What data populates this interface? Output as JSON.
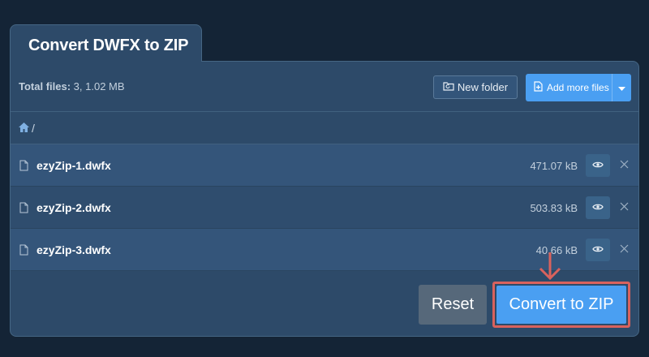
{
  "tab": {
    "title": "Convert DWFX to ZIP"
  },
  "toolbar": {
    "total_label": "Total files:",
    "total_value": "3, 1.02 MB",
    "new_folder_label": "New folder",
    "add_more_label": "Add more files"
  },
  "breadcrumb": {
    "separator": "/"
  },
  "files": [
    {
      "name": "ezyZip-1.dwfx",
      "size": "471.07 kB"
    },
    {
      "name": "ezyZip-2.dwfx",
      "size": "503.83 kB"
    },
    {
      "name": "ezyZip-3.dwfx",
      "size": "40.66 kB"
    }
  ],
  "actions": {
    "reset_label": "Reset",
    "convert_label": "Convert to ZIP"
  },
  "colors": {
    "background": "#142436",
    "panel": "#2d4a69",
    "accent": "#4a9ff2",
    "highlight": "#d9625d"
  },
  "icons": {
    "new_folder": "folder-sync-icon",
    "add_files": "file-plus-icon",
    "caret": "caret-down-icon",
    "home": "home-icon",
    "file": "file-icon",
    "preview": "eye-icon",
    "remove": "close-icon",
    "pointer": "arrow-down-icon"
  }
}
